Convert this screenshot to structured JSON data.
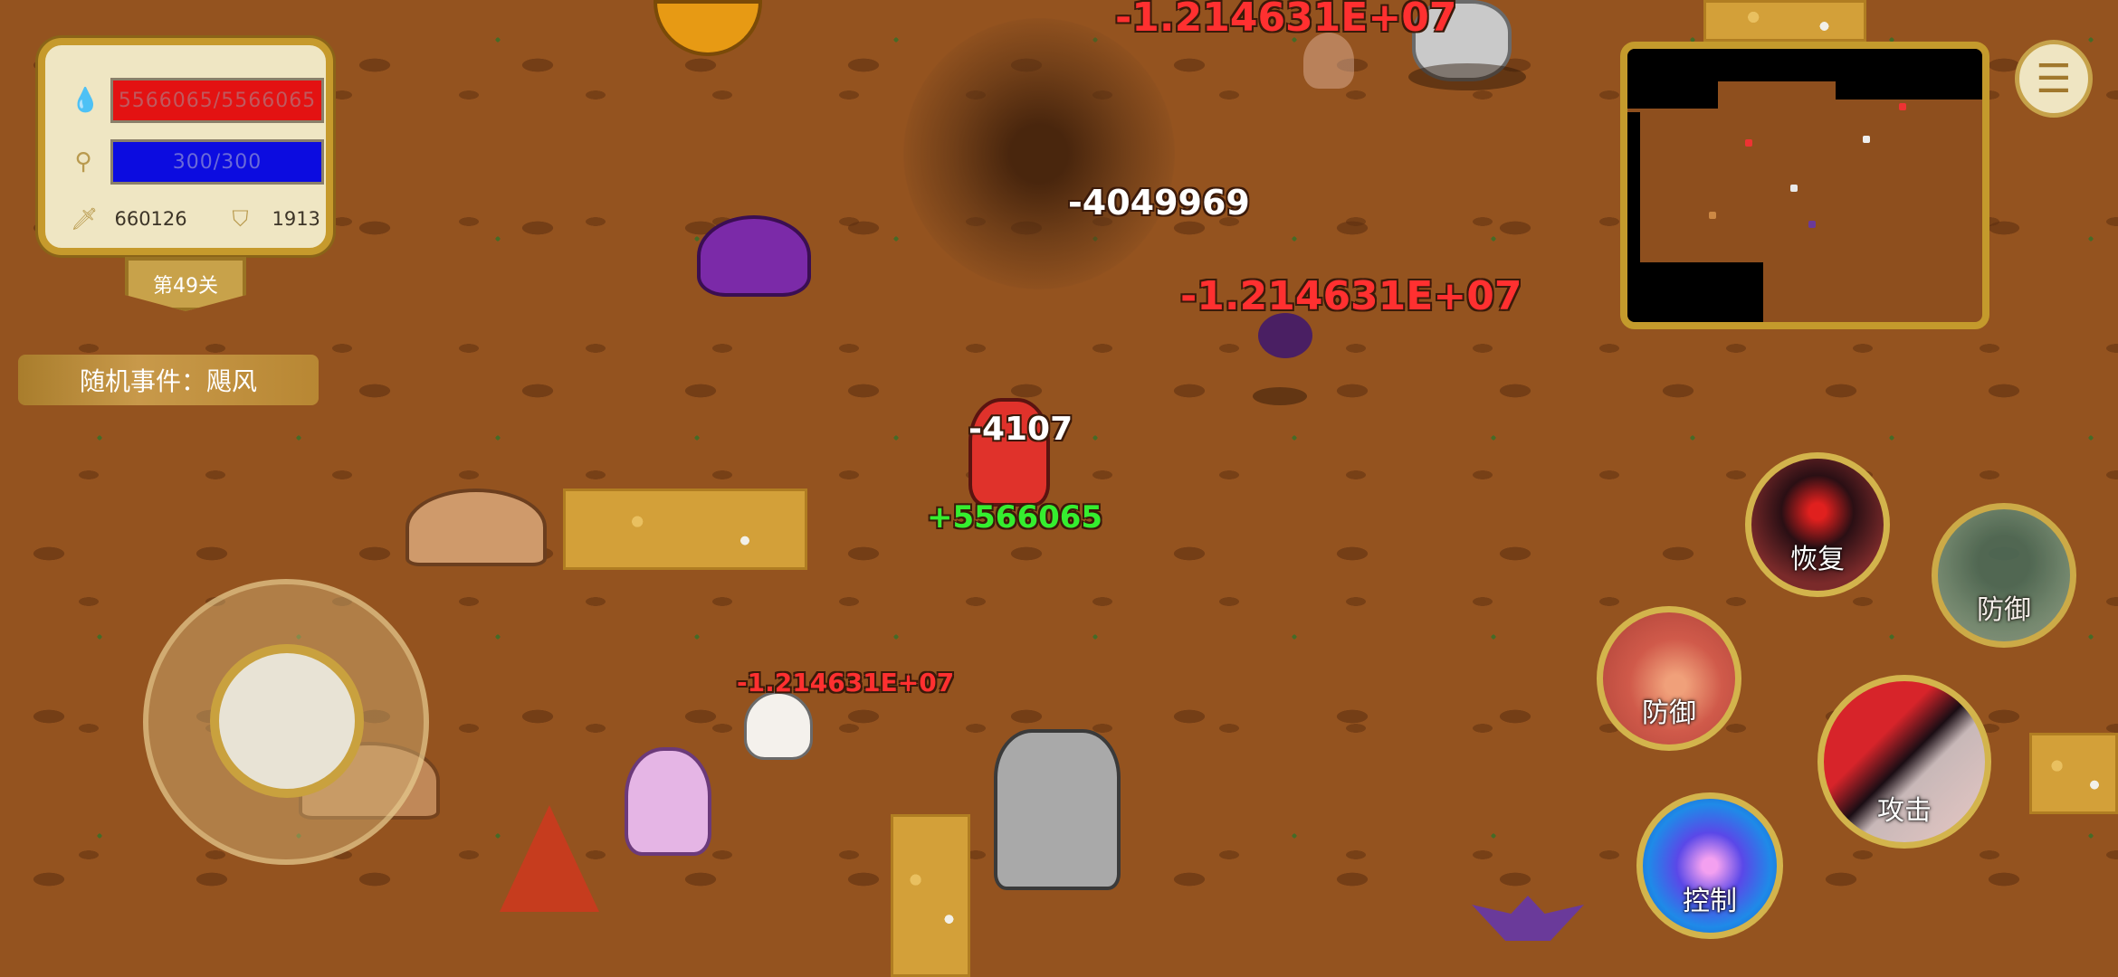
{
  "hud": {
    "hp_text": "5566065/5566065",
    "mp_text": "300/300",
    "attack_value": "660126",
    "defense_value": "1913",
    "level_label": "第49关",
    "random_event": "随机事件：飓风"
  },
  "icons": {
    "hp": "droplet-icon",
    "mp": "magnifier-icon",
    "attack": "sword-icon",
    "defense": "shield-icon",
    "menu": "menu-icon"
  },
  "colors": {
    "hp_bar": "#e31212",
    "mp_bar": "#0c0ce0",
    "panel_border": "#c69a2c",
    "damage_red": "#ff3030",
    "heal_green": "#35ee2f"
  },
  "skills": {
    "recover": "恢复",
    "defense_1": "防御",
    "defense_2": "防御",
    "attack": "攻击",
    "control": "控制"
  },
  "damage_numbers": {
    "top_red": "-1.214631E+07",
    "mid_red": "-1.214631E+07",
    "ghost_red": "-1.214631E+07",
    "tornado_white": "-4049969",
    "player_white": "-4107",
    "player_green": "+5566065"
  }
}
